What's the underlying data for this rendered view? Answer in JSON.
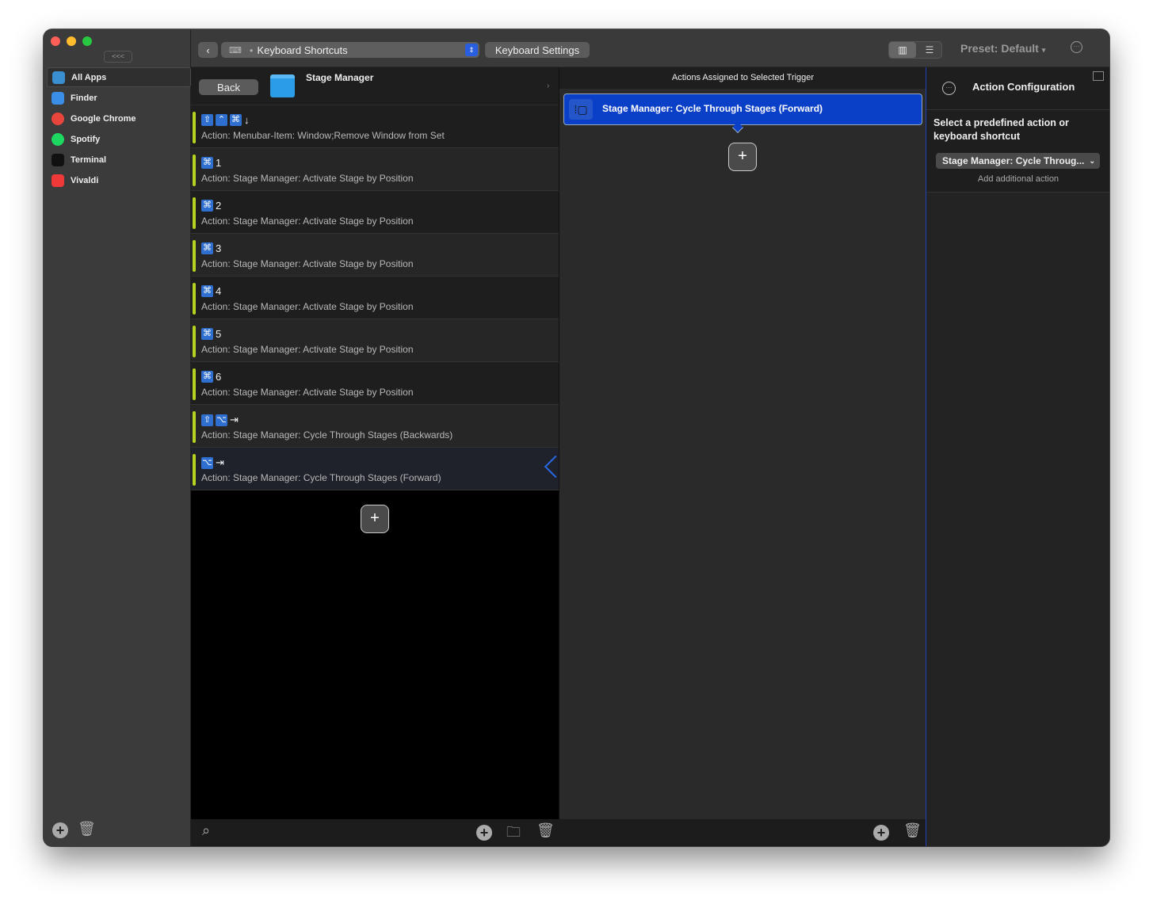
{
  "window": {
    "collapse_label": "<<<"
  },
  "sidebar": {
    "apps": [
      {
        "label": "All Apps",
        "color": "#3a8fd0"
      },
      {
        "label": "Finder",
        "color": "#3b8ee8"
      },
      {
        "label": "Google Chrome",
        "color": "#e8453c"
      },
      {
        "label": "Spotify",
        "color": "#1ed760"
      },
      {
        "label": "Terminal",
        "color": "#111111"
      },
      {
        "label": "Vivaldi",
        "color": "#ef3939"
      }
    ],
    "selected": "All Apps"
  },
  "toolbar": {
    "trigger_type": "Keyboard Shortcuts",
    "settings_label": "Keyboard Settings",
    "preset_label": "Preset: Default"
  },
  "triggers": {
    "back_label": "Back",
    "folder_title": "Stage Manager",
    "items": [
      {
        "keys": [
          "⇧",
          "⌃",
          "⌘"
        ],
        "key": "↓",
        "action": "Action: Menubar-Item: Window;Remove Window from Set"
      },
      {
        "keys": [
          "⌘"
        ],
        "key": "1",
        "action": "Action: Stage Manager: Activate Stage by Position"
      },
      {
        "keys": [
          "⌘"
        ],
        "key": "2",
        "action": "Action: Stage Manager: Activate Stage by Position"
      },
      {
        "keys": [
          "⌘"
        ],
        "key": "3",
        "action": "Action: Stage Manager: Activate Stage by Position"
      },
      {
        "keys": [
          "⌘"
        ],
        "key": "4",
        "action": "Action: Stage Manager: Activate Stage by Position"
      },
      {
        "keys": [
          "⌘"
        ],
        "key": "5",
        "action": "Action: Stage Manager: Activate Stage by Position"
      },
      {
        "keys": [
          "⌘"
        ],
        "key": "6",
        "action": "Action: Stage Manager: Activate Stage by Position"
      },
      {
        "keys": [
          "⇧",
          "⌥"
        ],
        "key": "⇥",
        "action": "Action: Stage Manager: Cycle Through Stages (Backwards)"
      },
      {
        "keys": [
          "⌥"
        ],
        "key": "⇥",
        "action": "Action: Stage Manager: Cycle Through Stages (Forward)",
        "selected": true
      }
    ],
    "add_label": "+"
  },
  "actions": {
    "header": "Actions Assigned to Selected Trigger",
    "items": [
      {
        "label": "Stage Manager: Cycle Through Stages (Forward)"
      }
    ],
    "add_label": "+",
    "accent": "#0a3fc7"
  },
  "config": {
    "title": "Action Configuration",
    "prompt": "Select a predefined action or keyboard shortcut",
    "selected_action": "Stage Manager: Cycle Throug...",
    "add_additional": "Add additional action"
  }
}
